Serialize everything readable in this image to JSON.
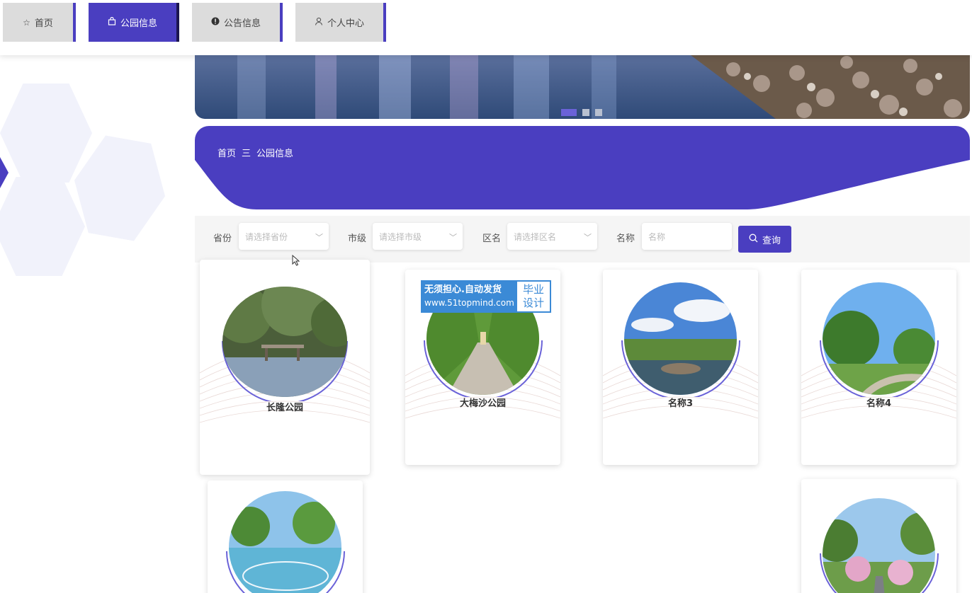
{
  "nav": {
    "items": [
      {
        "label": "首页",
        "icon": "star-icon"
      },
      {
        "label": "公园信息",
        "icon": "bag-icon"
      },
      {
        "label": "公告信息",
        "icon": "alert-icon"
      },
      {
        "label": "个人中心",
        "icon": "user-icon"
      }
    ],
    "active": "公园信息"
  },
  "breadcrumb": {
    "home": "首页",
    "sep": "三",
    "current": "公园信息"
  },
  "filters": {
    "province_label": "省份",
    "province_placeholder": "请选择省份",
    "city_label": "市级",
    "city_placeholder": "请选择市级",
    "district_label": "区名",
    "district_placeholder": "请选择区名",
    "name_label": "名称",
    "name_placeholder": "名称",
    "query_label": "查询"
  },
  "cards": [
    {
      "name": "长隆公园"
    },
    {
      "name": "大梅沙公园"
    },
    {
      "name": "名称3"
    },
    {
      "name": "名称4"
    }
  ],
  "watermark": {
    "line1": "无须担心.自动发货",
    "line2": "www.51topmind.com",
    "side1": "毕业",
    "side2": "设计"
  },
  "colors": {
    "accent": "#4a3ec0"
  }
}
